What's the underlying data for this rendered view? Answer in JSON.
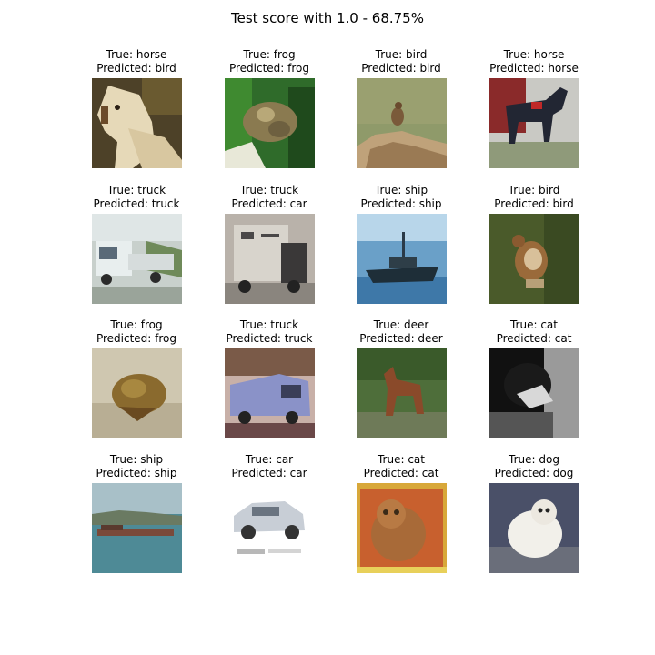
{
  "figure": {
    "title": "Test score with 1.0 - 68.75%"
  },
  "chart_data": {
    "type": "image_grid",
    "title": "Test score with 1.0 - 68.75%",
    "rows": 4,
    "cols": 4,
    "accuracy_percent": 68.75,
    "panels": [
      {
        "true": "True: horse",
        "pred": "Predicted: bird",
        "subject": "horse"
      },
      {
        "true": "True: frog",
        "pred": "Predicted: frog",
        "subject": "frog"
      },
      {
        "true": "True: bird",
        "pred": "Predicted: bird",
        "subject": "bird"
      },
      {
        "true": "True: horse",
        "pred": "Predicted: horse",
        "subject": "horse"
      },
      {
        "true": "True: truck",
        "pred": "Predicted: truck",
        "subject": "truck"
      },
      {
        "true": "True: truck",
        "pred": "Predicted: car",
        "subject": "truck"
      },
      {
        "true": "True: ship",
        "pred": "Predicted: ship",
        "subject": "ship"
      },
      {
        "true": "True: bird",
        "pred": "Predicted: bird",
        "subject": "bird"
      },
      {
        "true": "True: frog",
        "pred": "Predicted: frog",
        "subject": "frog"
      },
      {
        "true": "True: truck",
        "pred": "Predicted: truck",
        "subject": "truck"
      },
      {
        "true": "True: deer",
        "pred": "Predicted: deer",
        "subject": "deer"
      },
      {
        "true": "True: cat",
        "pred": "Predicted: cat",
        "subject": "cat"
      },
      {
        "true": "True: ship",
        "pred": "Predicted: ship",
        "subject": "ship"
      },
      {
        "true": "True: car",
        "pred": "Predicted: car",
        "subject": "car"
      },
      {
        "true": "True: cat",
        "pred": "Predicted: cat",
        "subject": "cat"
      },
      {
        "true": "True: dog",
        "pred": "Predicted: dog",
        "subject": "dog"
      }
    ]
  }
}
